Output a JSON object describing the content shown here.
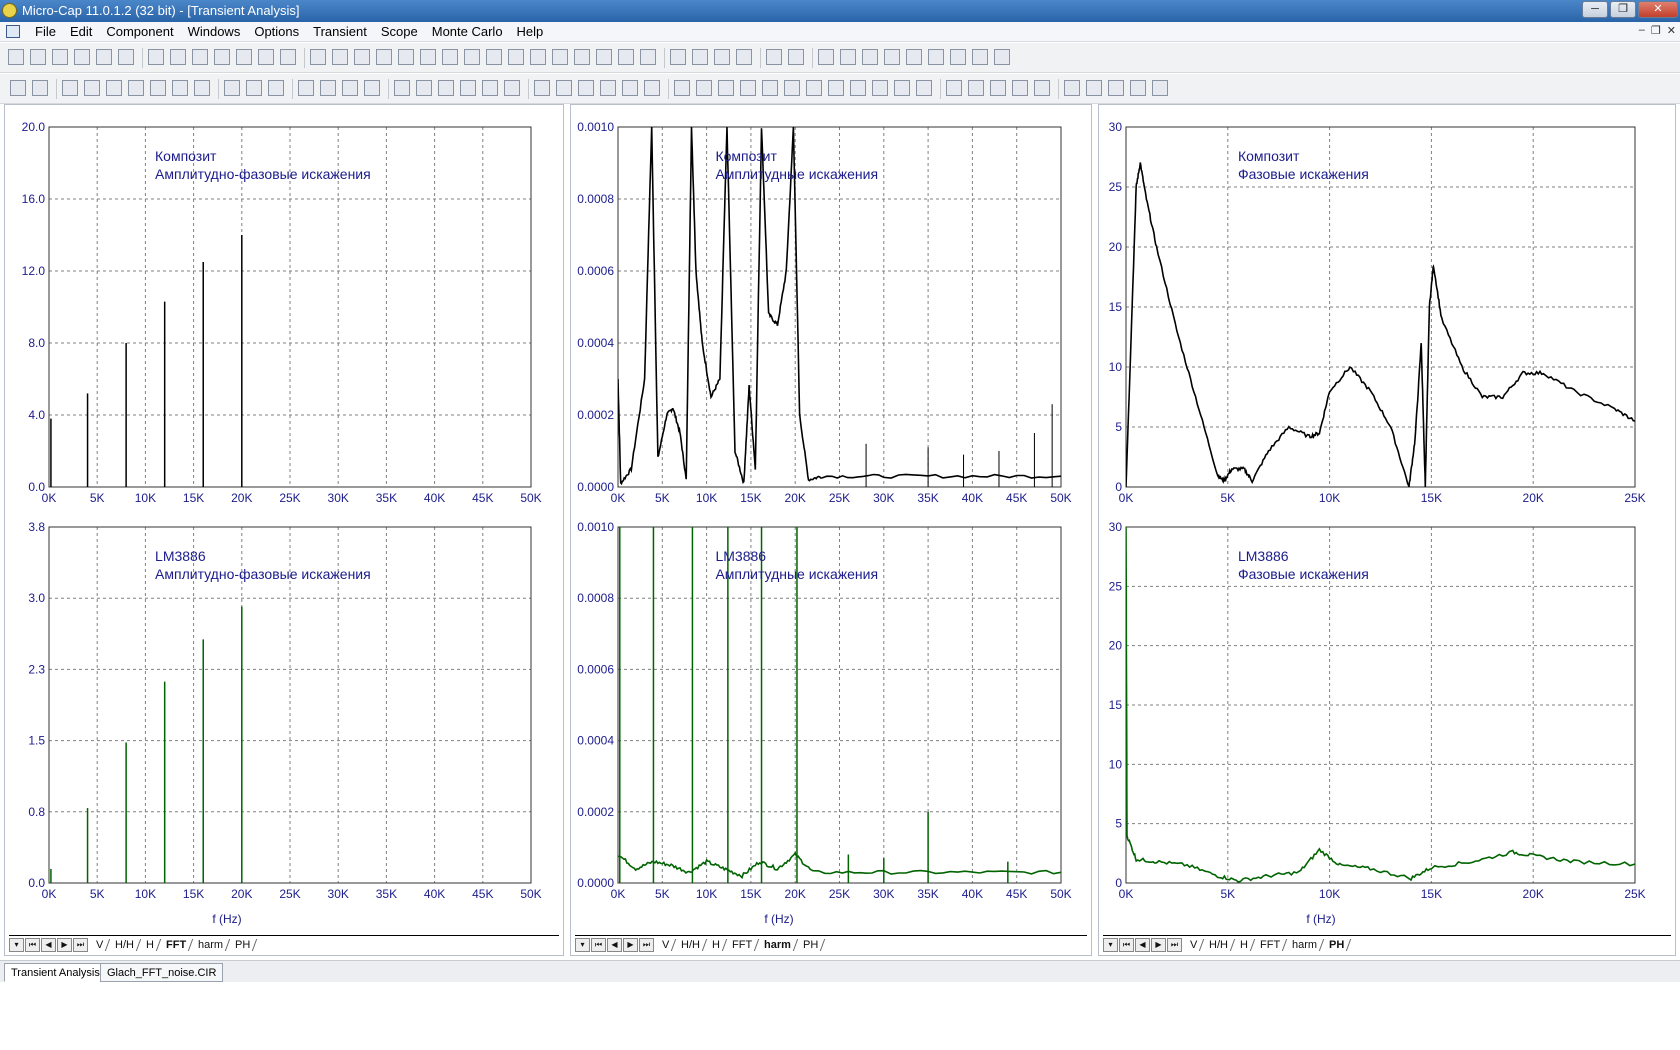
{
  "window": {
    "title": "Micro-Cap 11.0.1.2 (32 bit) - [Transient Analysis]",
    "buttons": [
      "─",
      "❐",
      "✕"
    ]
  },
  "menu": {
    "items": [
      "File",
      "Edit",
      "Component",
      "Windows",
      "Options",
      "Transient",
      "Scope",
      "Monte Carlo",
      "Help"
    ],
    "mdi_buttons": [
      "–",
      "❐",
      "✕"
    ]
  },
  "panes": [
    {
      "tabs": [
        "V",
        "H/H",
        "H",
        "FFT",
        "harm",
        "PH"
      ],
      "active_tab": "FFT",
      "xlabel": "f (Hz)"
    },
    {
      "tabs": [
        "V",
        "H/H",
        "H",
        "FFT",
        "harm",
        "PH"
      ],
      "active_tab": "harm",
      "xlabel": "f (Hz)"
    },
    {
      "tabs": [
        "V",
        "H/H",
        "H",
        "FFT",
        "harm",
        "PH"
      ],
      "active_tab": "PH",
      "xlabel": "f (Hz)"
    }
  ],
  "bottom_tabs": [
    "Transient Analysis",
    "Glach_FFT_noise.CIR"
  ],
  "colors": {
    "plot_text": "#1c1c8c",
    "trace_top": "#000000",
    "trace_bottom": "#006400",
    "grid": "#808080"
  },
  "chart_data": [
    {
      "id": "fft-top",
      "type": "line",
      "annotation": [
        "Композит",
        "Амплитудно-фазовые искажения"
      ],
      "xticks": [
        "0K",
        "5K",
        "10K",
        "15K",
        "20K",
        "25K",
        "30K",
        "35K",
        "40K",
        "45K",
        "50K"
      ],
      "yticks": [
        "0.0",
        "4.0",
        "8.0",
        "12.0",
        "16.0",
        "20.0"
      ],
      "xlim": [
        0,
        50000
      ],
      "ylim": [
        0,
        20
      ],
      "spikes": [
        [
          200,
          3.8
        ],
        [
          4000,
          5.2
        ],
        [
          8000,
          8.0
        ],
        [
          12000,
          10.3
        ],
        [
          16000,
          12.5
        ],
        [
          20000,
          14.0
        ]
      ],
      "trace": "trace_top",
      "grid": true
    },
    {
      "id": "fft-bottom",
      "type": "line",
      "annotation": [
        "LM3886",
        "Амплитудно-фазовые искажения"
      ],
      "xticks": [
        "0K",
        "5K",
        "10K",
        "15K",
        "20K",
        "25K",
        "30K",
        "35K",
        "40K",
        "45K",
        "50K"
      ],
      "yticks": [
        "0.0",
        "0.8",
        "1.5",
        "2.3",
        "3.0",
        "3.8"
      ],
      "xlim": [
        0,
        50000
      ],
      "ylim": [
        0,
        3.8
      ],
      "spikes": [
        [
          200,
          0.15
        ],
        [
          4000,
          0.8
        ],
        [
          8000,
          1.5
        ],
        [
          12000,
          2.15
        ],
        [
          16000,
          2.6
        ],
        [
          20000,
          2.95
        ]
      ],
      "trace": "trace_bottom",
      "grid": true
    },
    {
      "id": "harm-top",
      "type": "line",
      "annotation": [
        "Композит",
        "Амплитудные искажения"
      ],
      "xticks": [
        "0K",
        "5K",
        "10K",
        "15K",
        "20K",
        "25K",
        "30K",
        "35K",
        "40K",
        "45K",
        "50K"
      ],
      "yticks": [
        "0.0000",
        "0.0002",
        "0.0004",
        "0.0006",
        "0.0008",
        "0.0010"
      ],
      "xlim": [
        0,
        50000
      ],
      "ylim": [
        0,
        0.001
      ],
      "curve": [
        [
          0,
          0.0003
        ],
        [
          300,
          1e-05
        ],
        [
          1500,
          5e-05
        ],
        [
          3000,
          0.0003
        ],
        [
          3800,
          0.001
        ],
        [
          4500,
          8e-05
        ],
        [
          5500,
          0.0002
        ],
        [
          6200,
          0.00022
        ],
        [
          7000,
          0.00015
        ],
        [
          7700,
          2e-05
        ],
        [
          8300,
          0.001
        ],
        [
          8800,
          0.0006
        ],
        [
          9500,
          0.0004
        ],
        [
          10500,
          0.00025
        ],
        [
          11500,
          0.0003
        ],
        [
          12300,
          0.001
        ],
        [
          13200,
          0.0001
        ],
        [
          14200,
          1e-05
        ],
        [
          14800,
          0.00028
        ],
        [
          15500,
          5e-05
        ],
        [
          16200,
          0.001
        ],
        [
          17000,
          0.00048
        ],
        [
          18000,
          0.00045
        ],
        [
          19000,
          0.0006
        ],
        [
          19800,
          0.001
        ],
        [
          20500,
          0.0002
        ],
        [
          21500,
          2e-05
        ],
        [
          23000,
          3e-05
        ],
        [
          30000,
          3e-05
        ],
        [
          40000,
          3e-05
        ],
        [
          50000,
          3e-05
        ]
      ],
      "noise_peaks": [
        [
          28000,
          0.00012
        ],
        [
          35000,
          0.00011
        ],
        [
          39000,
          9e-05
        ],
        [
          43000,
          0.0001
        ],
        [
          47000,
          0.00015
        ],
        [
          49000,
          0.00023
        ]
      ],
      "trace": "trace_top",
      "grid": true
    },
    {
      "id": "harm-bottom",
      "type": "line",
      "annotation": [
        "LM3886",
        "Амплитудные искажения"
      ],
      "xticks": [
        "0K",
        "5K",
        "10K",
        "15K",
        "20K",
        "25K",
        "30K",
        "35K",
        "40K",
        "45K",
        "50K"
      ],
      "yticks": [
        "0.0000",
        "0.0002",
        "0.0004",
        "0.0006",
        "0.0008",
        "0.0010"
      ],
      "xlim": [
        0,
        50000
      ],
      "ylim": [
        0,
        0.001
      ],
      "curve": [
        [
          0,
          8e-05
        ],
        [
          2000,
          4e-05
        ],
        [
          4000,
          6e-05
        ],
        [
          6000,
          5e-05
        ],
        [
          8000,
          3e-05
        ],
        [
          10000,
          6e-05
        ],
        [
          12000,
          4e-05
        ],
        [
          14000,
          2e-05
        ],
        [
          16000,
          6e-05
        ],
        [
          18000,
          4e-05
        ],
        [
          20000,
          8e-05
        ],
        [
          22000,
          3e-05
        ],
        [
          30000,
          3e-05
        ],
        [
          40000,
          3e-05
        ],
        [
          50000,
          3e-05
        ]
      ],
      "spikes": [
        [
          200,
          0.001
        ],
        [
          4000,
          0.001
        ],
        [
          8400,
          0.001
        ],
        [
          12400,
          0.001
        ],
        [
          16200,
          0.001
        ],
        [
          20200,
          0.001
        ],
        [
          35000,
          0.0002
        ],
        [
          26000,
          8e-05
        ],
        [
          30000,
          7e-05
        ],
        [
          44000,
          6e-05
        ]
      ],
      "trace": "trace_bottom",
      "grid": true
    },
    {
      "id": "ph-top",
      "type": "line",
      "annotation": [
        "Композит",
        "Фазовые искажения"
      ],
      "xticks": [
        "0K",
        "5K",
        "10K",
        "15K",
        "20K",
        "25K"
      ],
      "yticks": [
        "0",
        "5",
        "10",
        "15",
        "20",
        "25",
        "30"
      ],
      "xlim": [
        0,
        25000
      ],
      "ylim": [
        0,
        30
      ],
      "curve": [
        [
          0,
          0
        ],
        [
          300,
          15
        ],
        [
          500,
          25
        ],
        [
          700,
          27
        ],
        [
          1000,
          24
        ],
        [
          1500,
          20
        ],
        [
          2500,
          13
        ],
        [
          3500,
          7
        ],
        [
          4500,
          1
        ],
        [
          4800,
          0.5
        ],
        [
          5200,
          1.5
        ],
        [
          5800,
          1.5
        ],
        [
          6200,
          0.5
        ],
        [
          7000,
          3
        ],
        [
          8000,
          5
        ],
        [
          9000,
          4.2
        ],
        [
          9500,
          4.5
        ],
        [
          10000,
          8
        ],
        [
          11000,
          10
        ],
        [
          12000,
          8
        ],
        [
          13000,
          5
        ],
        [
          13900,
          0
        ],
        [
          14200,
          4
        ],
        [
          14500,
          12
        ],
        [
          14700,
          0
        ],
        [
          14900,
          15
        ],
        [
          15100,
          18.5
        ],
        [
          15500,
          14
        ],
        [
          16500,
          10
        ],
        [
          17500,
          7.5
        ],
        [
          18500,
          7.5
        ],
        [
          19500,
          9.5
        ],
        [
          20500,
          9.5
        ],
        [
          22000,
          8
        ],
        [
          24000,
          6.5
        ],
        [
          25000,
          5.5
        ]
      ],
      "trace": "trace_top",
      "grid": true
    },
    {
      "id": "ph-bottom",
      "type": "line",
      "annotation": [
        "LM3886",
        "Фазовые искажения"
      ],
      "xticks": [
        "0K",
        "5K",
        "10K",
        "15K",
        "20K",
        "25K"
      ],
      "yticks": [
        "0",
        "5",
        "10",
        "15",
        "20",
        "25",
        "30"
      ],
      "xlim": [
        0,
        25000
      ],
      "ylim": [
        0,
        30
      ],
      "curve": [
        [
          0,
          30
        ],
        [
          50,
          4
        ],
        [
          500,
          2
        ],
        [
          1500,
          1.8
        ],
        [
          3000,
          1.5
        ],
        [
          4500,
          0.6
        ],
        [
          5500,
          0.2
        ],
        [
          7000,
          0.6
        ],
        [
          8500,
          0.9
        ],
        [
          9500,
          2.8
        ],
        [
          10500,
          1.5
        ],
        [
          12000,
          1.2
        ],
        [
          14000,
          0.4
        ],
        [
          15000,
          1.3
        ],
        [
          17000,
          1.8
        ],
        [
          19000,
          2.6
        ],
        [
          20000,
          2.3
        ],
        [
          22000,
          1.8
        ],
        [
          25000,
          1.6
        ]
      ],
      "trace": "trace_bottom",
      "grid": true
    }
  ]
}
